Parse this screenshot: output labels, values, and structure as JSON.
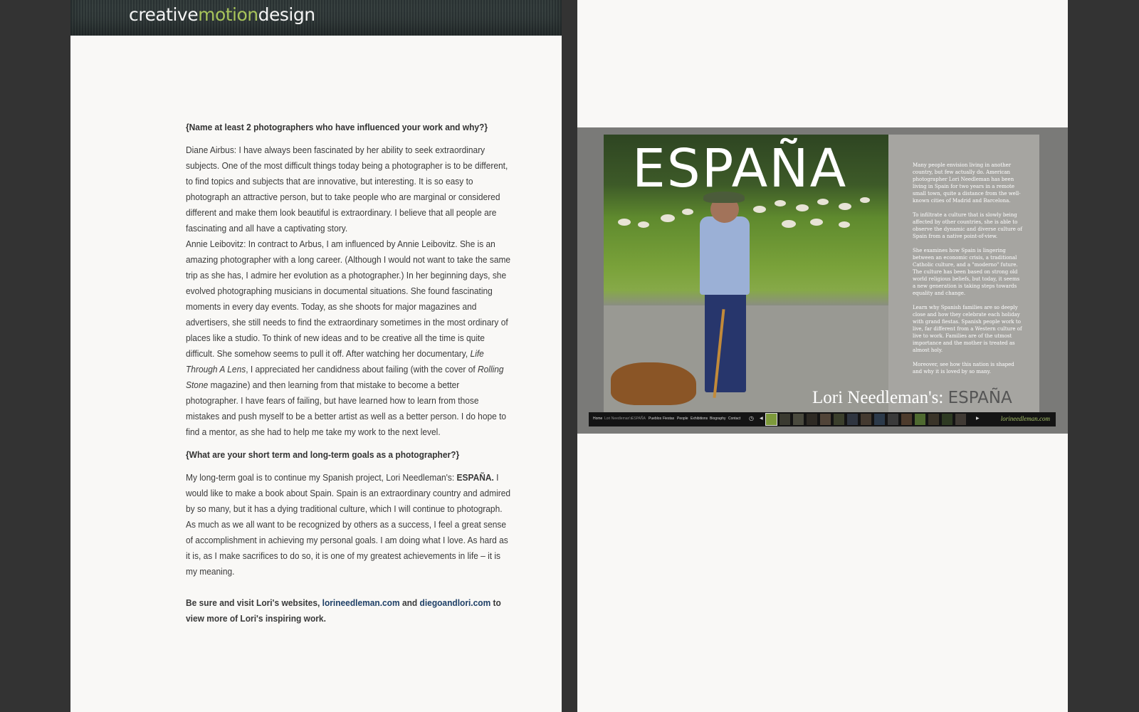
{
  "header": {
    "logo_part1": "creative",
    "logo_part2": "motion",
    "logo_part3": "design"
  },
  "article": {
    "q1": "{Name at least 2 photographers who have influenced your work and why?}",
    "p1": "Diane Airbus: I have always been fascinated by her ability to seek extraordinary subjects. One of the most difficult things today being a photographer is to be different, to find topics and subjects that are innovative, but interesting. It is so easy to photograph an attractive person, but to take people who are marginal or considered different and make them look beautiful is extraordinary.  I believe that all people are fascinating and all have a captivating story.",
    "p2_a": " Annie Leibovitz: In contract to Arbus, I am influenced by Annie Leibovitz. She is an amazing photographer with a long career.  (Although I would not want to take the same trip as she has, I admire her evolution as a photographer.) In her beginning days, she evolved photographing musicians in documental situations. She found fascinating moments in every day events. Today, as she shoots for major magazines and advertisers, she still needs to find the extraordinary sometimes in the most ordinary of places like a studio. To think of new ideas and to be creative all the time is quite difficult.  She somehow seems to pull it off. After watching her documentary, ",
    "p2_film": "Life Through A Lens",
    "p2_b": ", I appreciated her candidness about failing (with the cover of ",
    "p2_mag": "Rolling Stone",
    "p2_c": " magazine) and then learning from that mistake to become a better photographer. I have fears of failing, but have learned how to learn from those mistakes and push myself to be a better artist as well as a better person. I do hope to find a mentor, as she had to help me take my work to the next level.",
    "q2": "{What are your short term and long-term goals as a photographer?}",
    "p3_a": "My long-term goal is to continue my Spanish project, Lori Needleman's: ",
    "p3_project": "ESPAÑA.",
    "p3_b": " I would like to make a book about Spain. Spain is an extraordinary country and admired by so many, but it has a dying traditional culture, which I will continue to photograph. As much as we all want to be recognized by others as a success, I feel a great sense of accomplishment in achieving my personal goals. I am doing what I love. As hard as it is, as I make sacrifices to do so, it is one of my greatest achievements in life – it is my meaning.",
    "closing_a": "Be sure and visit Lori's websites, ",
    "link1": "lorineedleman.com",
    "closing_b": " and ",
    "link2": "diegoandlori.com",
    "closing_c": " to view more of Lori's inspiring work."
  },
  "screenshot": {
    "title": "ESPAÑA",
    "side_paragraphs": [
      "Many people envision living in another country, but few actually do. American photographer Lori Needleman has been living in Spain for two years in a remote small town, quite a distance from the well-known cities of Madrid and Barcelona.",
      "To infiltrate a culture that is slowly being affected by other countries, she is able to observe the dynamic and diverse culture of Spain from a native point-of-view.",
      "She examines how Spain is lingering between an economic crisis, a traditional Catholic culture, and a \"moderno\" future. The culture has been based on strong old world religious beliefs, but today, it seems a new generation is taking steps towards equality and change.",
      "Learn why Spanish families are so deeply close and how they celebrate each holiday with grand fiestas. Spanish people work to live, far different from a Western culture of live to work. Families are of the utmost importance and the mother is treated as almost holy.",
      "Moreover, see how this nation is shaped and why it is loved by so many."
    ],
    "caption_name": "Lori Needleman's:",
    "caption_title": "ESPAÑA",
    "nav": [
      "Home",
      "Lori Needleman's",
      "ESPAÑA",
      "Pueblos",
      "Fiestas",
      "People",
      "Exhibitions",
      "Biography",
      "Contact"
    ],
    "prev_arrow": "◀",
    "next_arrow": "▶",
    "site": "lorineedleman.com"
  }
}
